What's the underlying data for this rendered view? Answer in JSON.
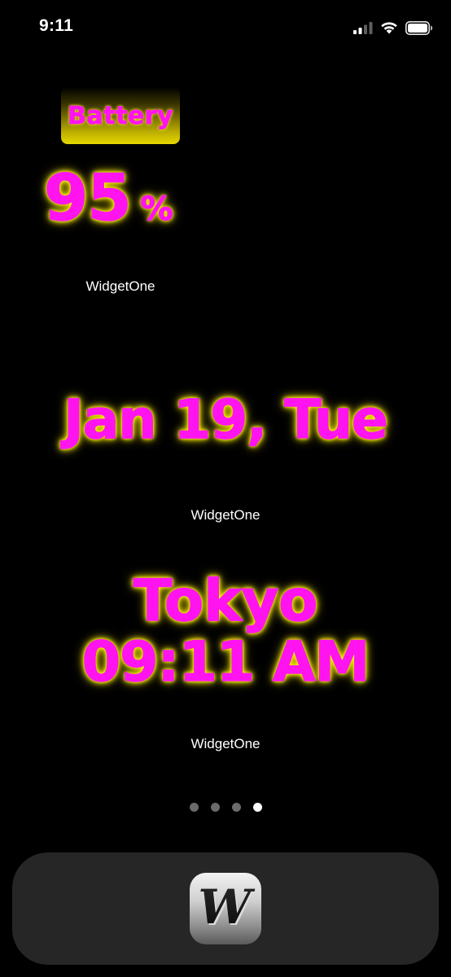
{
  "status_bar": {
    "time": "9:11",
    "icons": [
      "cellular-signal-icon",
      "wifi-icon",
      "battery-icon"
    ]
  },
  "widgets": {
    "battery": {
      "title": "Battery",
      "value": "95",
      "unit": "%",
      "caption": "WidgetOne"
    },
    "date": {
      "text": "Jan 19, Tue",
      "caption": "WidgetOne"
    },
    "world_clock": {
      "city": "Tokyo",
      "time": "09:11 AM",
      "caption": "WidgetOne"
    }
  },
  "page_indicator": {
    "count": 4,
    "active_index": 3
  },
  "dock": {
    "apps": [
      {
        "icon": "widgetone-app-icon",
        "glyph": "W"
      }
    ]
  },
  "colors": {
    "background": "#000000",
    "neon_text": "#ff14f0",
    "neon_glow": "#ffff00",
    "caption": "#ffffff",
    "dock": "#262626"
  }
}
